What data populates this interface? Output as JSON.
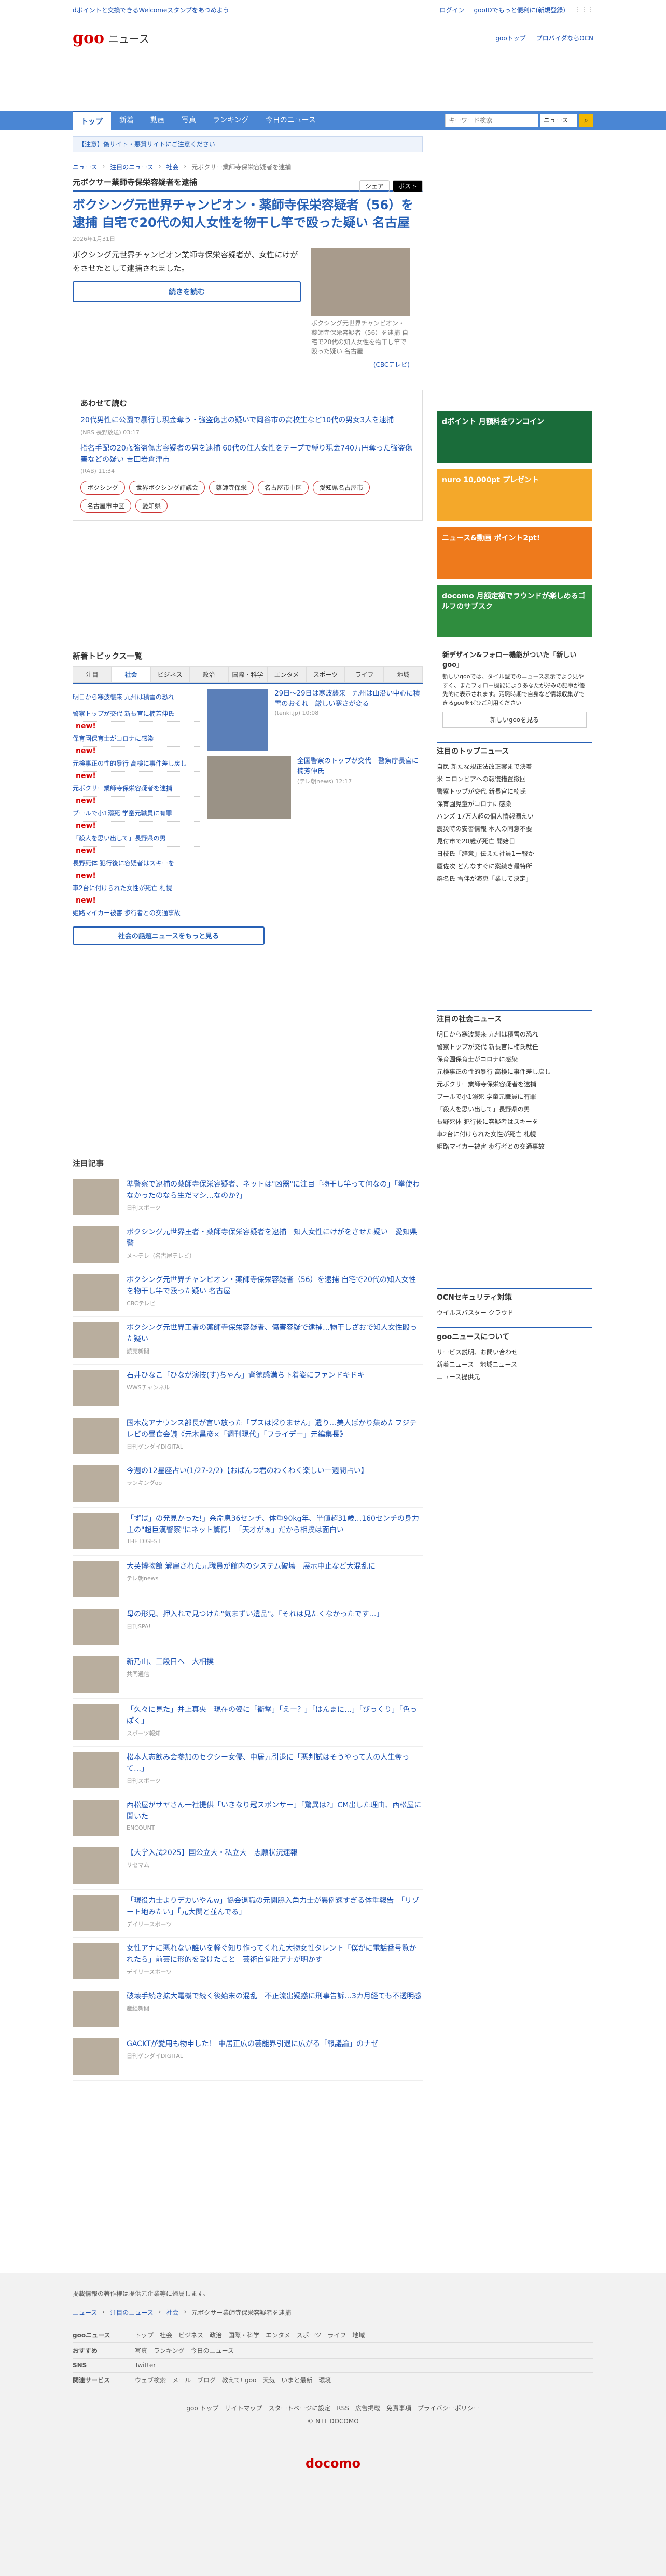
{
  "topbar": {
    "promo": "dポイントと交換できるWelcomeスタンプをあつめよう",
    "login": "ログイン",
    "link": "gooIDでもっと便利に(新規登録)"
  },
  "header": {
    "logo": "goo",
    "section": "ニュース",
    "links": [
      "gooトップ",
      "プロバイダならOCN"
    ]
  },
  "nav": {
    "tabs": [
      "トップ",
      "新着",
      "動画",
      "写真",
      "ランキング",
      "今日のニュース"
    ],
    "search_placeholder": "キーワード検索",
    "search_select": "ニュース"
  },
  "notice": "【注意】偽サイト・悪質サイトにご注意ください",
  "breadcrumb": [
    "ニュース",
    "注目のニュース",
    "社会",
    "元ボクサー業師寺保栄容疑者を逮捕"
  ],
  "article": {
    "category": "元ボクサー業師寺保栄容疑者を逮捕",
    "title": "ボクシング元世界チャンピオン・薬師寺保栄容疑者（56）を逮捕 自宅で20代の知人女性を物干し竿で殴った疑い 名古屋",
    "date": "2026年1月31日",
    "lead": "ボクシング元世界チャンピオン業師寺保栄容疑者が、女性にけがをさせたとして逮捕されました。",
    "continue": "続きを読む",
    "caption": "ボクシング元世界チャンピオン・薬師寺保栄容疑者（56）を逮捕 自宅で20代の知人女性を物干し竿で殴った疑い 名古屋",
    "source": "(CBCテレビ)",
    "post": "ポスト",
    "share": "シェア"
  },
  "related": {
    "heading": "あわせて読む",
    "items": [
      {
        "t": "20代男性に公園で暴行し現金奪う・強盗傷害の疑いで岡谷市の高校生など10代の男女3人を逮捕",
        "m": "(NBS 長野放送) 03:17"
      },
      {
        "t": "指名手配の20歳強盗傷害容疑者の男を逮捕 60代の住人女性をテープで縛り現金740万円奪った強盗傷害などの疑い 吉田岩倉津市",
        "m": "(RAB) 11:34"
      }
    ],
    "tags": [
      "ボクシング",
      "世界ボクシング評議会",
      "薬師寺保栄",
      "名古屋市中区",
      "愛知県名古屋市",
      "名古屋市中区",
      "愛知県"
    ]
  },
  "topics": {
    "heading": "新着トピックス一覧",
    "tabs": [
      "注目",
      "社会",
      "ビジネス",
      "政治",
      "国際・科学",
      "エンタメ",
      "スポーツ",
      "ライフ",
      "地域"
    ],
    "list": [
      "明日から寒波襲来 九州は積雪の恐れ",
      "警察トップが交代 新長官に楠芳伸氏",
      "保育園保育士がコロナに感染",
      "元検事正の性的暴行 高検に事件差し戻し",
      "元ボクサー業師寺保栄容疑者を逮捕",
      "ブールで小1溺死 学童元職員に有罪",
      "「殺人を思い出して」長野県の男",
      "長野死体 犯行後に容疑者はスキーを",
      "車2台に付けられた女性が死亡 札幌",
      "姫路マイカー被害 歩行者との交通事故"
    ],
    "news": [
      false,
      true,
      true,
      true,
      true,
      true,
      true,
      true,
      true,
      false
    ],
    "pics": [
      {
        "t": "29日〜29日は寒波襲来　九州は山沿い中心に積雪のおそれ　厳しい寒さが変る",
        "m": "(tenki.jp) 10:08"
      },
      {
        "t": "全国警察のトップが交代　警察庁長官に楠芳伸氏",
        "m": "(テレ朝news) 12:17"
      }
    ],
    "more": "社会の話題ニュースをもっと見る"
  },
  "attention": {
    "heading": "注目記事",
    "items": [
      {
        "t": "準警察で逮捕の薬師寺保栄容疑者、ネットは\"凶器\"に注目「物干し竿って何なの」「拳使わなかったのなら生だマシ…なのか?」",
        "s": "日刊スポーツ"
      },
      {
        "t": "ボクシング元世界王者・薬師寺保栄容疑者を逮捕　知人女性にけがをさせた疑い　愛知県警",
        "s": "メ～テレ（名古屋テレビ）"
      },
      {
        "t": "ボクシング元世界チャンピオン・薬師寺保栄容疑者（56）を逮捕 自宅で20代の知人女性を物干し竿で殴った疑い 名古屋",
        "s": "CBCテレビ"
      },
      {
        "t": "ボクシング元世界王者の薬師寺保栄容疑者、傷害容疑で逮捕…物干しざおで知人女性殴った疑い",
        "s": "読売新聞"
      },
      {
        "t": "石井ひなこ「ひなが演技(す)ちゃん」背徳感満ち下着姿にファンドキドキ",
        "s": "WWSチャンネル"
      },
      {
        "t": "国木茂アナウンス部長が言い放った「プスは採りません」遺り…美人ばかり集めたフジテレビの昼食会議《元木昌彦×「週刊現代」「フライデー」元編集長》",
        "s": "日刊ゲンダイDIGITAL"
      },
      {
        "t": "今週の12星座占い(1/27-2/2)【おばんつ君のわくわく楽しい一週間占い】",
        "s": "ランキングoo"
      },
      {
        "t": "「ずば」の発見かった!」余命息36センチ、体重90kg年、半値超31歳…160センチの身力主の\"超巨漢警察\"にネット驚愕！「天才がぁ」だから相撲は面白い",
        "s": "THE DIGEST"
      },
      {
        "t": "大英博物館 解雇された元職員が館内のシステム破壊　展示中止など大混乱に",
        "s": "テレ朝news"
      },
      {
        "t": "母の形見、押入れで見つけた\"気まずい遺品\"。「それは見たくなかったです…」",
        "s": "日刊SPA!"
      },
      {
        "t": "新乃山、三段目へ　大相撲",
        "s": "共同通信"
      },
      {
        "t": "「久々に見た」井上真央　現在の姿に「衝撃」「えー？」「はんまに…」「びっくり」「色っぽく」",
        "s": "スポーツ報知"
      },
      {
        "t": "松本人志飲み会参加のセクシー女優、中居元引退に「悪判試はそうやって人の人生奪って…」",
        "s": "日刊スポーツ"
      },
      {
        "t": "西松屋がサヤさん一社提供「いきなり冠スポンサー」「驚異は?」CM出した理由、西松屋に聞いた",
        "s": "ENCOUNT"
      },
      {
        "t": "【大学入試2025】国公立大・私立大　志願状況速報",
        "s": "リセマム"
      },
      {
        "t": "「現役力士よりデカいやんw」協会退職の元関脇入角力士が異例速すぎる体重報告　「リゾート地みたい」「元大関と並んでる」",
        "s": "デイリースポーツ"
      },
      {
        "t": "女性アナに悪れない誰いを軽ぐ知り作ってくれた大物女性タレント「僕がに電話番号覧かれたら」前芸に形的を受けたこと　芸術自覚肚アナが明かす",
        "s": "デイリースポーツ"
      },
      {
        "t": "破壊手続き拡大電機で続く後始末の混乱　不正流出疑惑に刑事告訴…3カ月経ても不透明感",
        "s": "産経新聞"
      },
      {
        "t": "GACKTが愛用も物申した！ 中居正広の芸能界引退に広がる「報議論」のナゼ",
        "s": "日刊ゲンダイDIGITAL"
      }
    ]
  },
  "side": {
    "ads": [
      "dポイント 月額料金ワンコイン",
      "nuro 10,000pt プレゼント",
      "ニュース&動画 ポイント2pt!",
      "docomo 月額定額でラウンドが楽しめるゴルフのサブスク"
    ],
    "notice": "新デザイン&フォロー機能がついた「新しいgoo」",
    "notice_text": "新しいgooでは、タイル型でのニュース表示でより見やすく、またフォロー機能によりあなたが好みの記事が優先的に表示されます。汚職時期で自身など情報収集ができるgooをぜひご利用ください",
    "notice_btn": "新しいgooを見る",
    "top": {
      "h": "注目のトップニュース",
      "items": [
        "自民 新たな規正法改正案まで決着",
        "米 コロンビアへの報復措置撤回",
        "警察トップが交代 新長官に楠氏",
        "保育園児童がコロナに感染",
        "ハンズ 17万人超の個人情報漏えい",
        "震災時の安否情報 本人の同意不要",
        "見付市で20歳が死亡 開始日",
        "日枝氏「辞意」伝えた社員1一報か",
        "慶佐次 どんなすぐに案続き最特所",
        "群名氏 雪伴が演恵「業して決定」"
      ]
    },
    "soc": {
      "h": "注目の社会ニュース",
      "items": [
        "明日から寒波襲来 九州は積雪の恐れ",
        "警察トップが交代 新長官に楠氏就任",
        "保育園保育士がコロナに感染",
        "元検事正の性的暴行 高検に事件差し戻し",
        "元ボクサー業師寺保栄容疑者を逮捕",
        "ブールで小1溺死 学童元職員に有罪",
        "「殺人を思い出して」長野県の男",
        "長野死体 犯行後に容疑者はスキーを",
        "車2台に付けられた女性が死亡 札幌",
        "姫路マイカー被害 歩行者との交通事故"
      ]
    },
    "ocn": {
      "h": "OCNセキュリティ対策",
      "t": "ウイルスバスター クラウド"
    },
    "about": {
      "h": "gooニュースについて",
      "items": [
        "サービス説明、お問い合わせ",
        "新着ニュース　地域ニュース",
        "ニュース提供元"
      ]
    }
  },
  "footer": {
    "note": "掲載情報の著作権は提供元企業等に帰属します。",
    "crumb": [
      "ニュース",
      "注目のニュース",
      "社会",
      "元ボクサー業師寺保栄容疑者を逮捕"
    ],
    "rows": [
      {
        "h": "gooニュース",
        "l": "トップ　社会　ビジネス　政治　国際・科学　エンタメ　スポーツ　ライフ　地域"
      },
      {
        "h": "おすすめ",
        "l": "写真　ランキング　今日のニュース"
      },
      {
        "h": "SNS",
        "l": "Twitter"
      },
      {
        "h": "関連サービス",
        "l": "ウェブ検索　メール　ブログ　教えて! goo　天気　いまと最新　環境"
      }
    ],
    "links": "goo トップ　サイトマップ　スタートページに設定　RSS　広告掲載　免責事項　プライバシーポリシー",
    "copy": "© NTT DOCOMO",
    "brand": "docomo"
  }
}
